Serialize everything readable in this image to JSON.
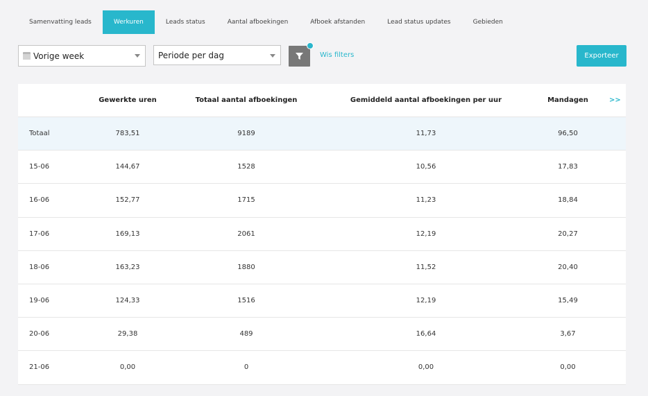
{
  "tabs": [
    {
      "label": "Samenvatting leads",
      "active": false
    },
    {
      "label": "Werkuren",
      "active": true
    },
    {
      "label": "Leads status",
      "active": false
    },
    {
      "label": "Aantal afboekingen",
      "active": false
    },
    {
      "label": "Afboek afstanden",
      "active": false
    },
    {
      "label": "Lead status updates",
      "active": false
    },
    {
      "label": "Gebieden",
      "active": false
    }
  ],
  "filters": {
    "period_value": "Vorige week",
    "range_value": "Periode per dag",
    "clear_label": "Wis filters",
    "export_label": "Exporteer"
  },
  "table": {
    "headers": [
      "",
      "Gewerkte uren",
      "Totaal aantal afboekingen",
      "Gemiddeld aantal afboekingen per uur",
      "Mandagen"
    ],
    "more_label": ">>",
    "rows": [
      [
        "Totaal",
        "783,51",
        "9189",
        "11,73",
        "96,50"
      ],
      [
        "15-06",
        "144,67",
        "1528",
        "10,56",
        "17,83"
      ],
      [
        "16-06",
        "152,77",
        "1715",
        "11,23",
        "18,84"
      ],
      [
        "17-06",
        "169,13",
        "2061",
        "12,19",
        "20,27"
      ],
      [
        "18-06",
        "163,23",
        "1880",
        "11,52",
        "20,40"
      ],
      [
        "19-06",
        "124,33",
        "1516",
        "12,19",
        "15,49"
      ],
      [
        "20-06",
        "29,38",
        "489",
        "16,64",
        "3,67"
      ],
      [
        "21-06",
        "0,00",
        "0",
        "0,00",
        "0,00"
      ]
    ]
  },
  "colors": {
    "accent": "#28b7cc",
    "filter_button": "#787878",
    "total_row": "#eef6fb",
    "background": "#f3f3f5"
  }
}
